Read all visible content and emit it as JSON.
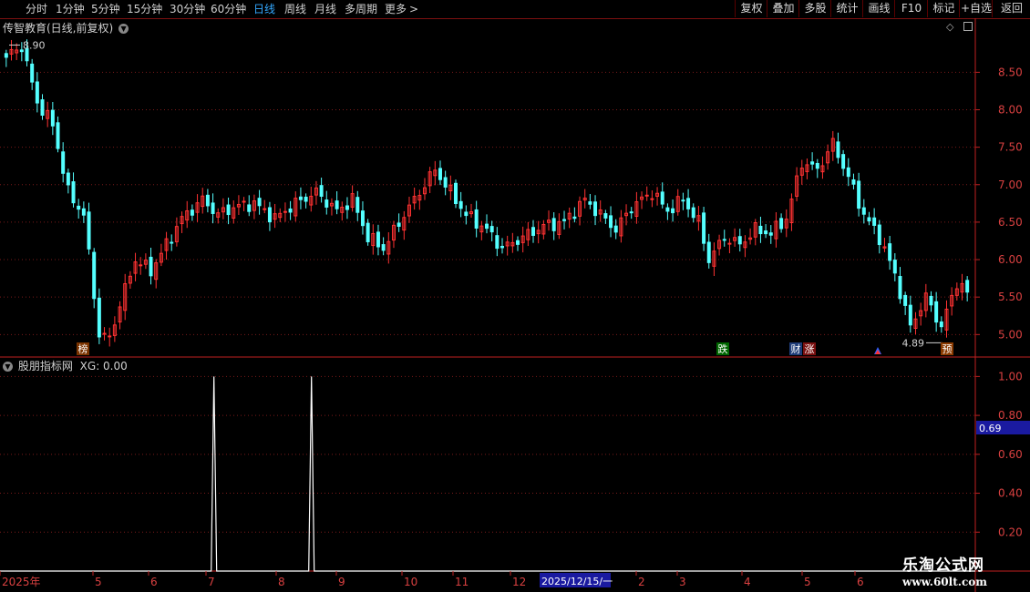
{
  "toolbar": {
    "periods": [
      "分时",
      "1分钟",
      "5分钟",
      "15分钟",
      "30分钟",
      "60分钟",
      "日线",
      "周线",
      "月线",
      "多周期",
      "更多"
    ],
    "active_period": "日线",
    "more_arrow": ">",
    "right_buttons": [
      "复权",
      "叠加",
      "多股",
      "统计",
      "画线",
      "F10",
      "标记",
      "+自选",
      "返回"
    ]
  },
  "main_panel": {
    "title": "传智教育(日线,前复权)",
    "high_label": "8.90",
    "low_label": "4.89",
    "price_ticks": [
      "8.50",
      "8.00",
      "7.50",
      "7.00",
      "6.50",
      "6.00",
      "5.50",
      "5.00"
    ]
  },
  "markers": [
    {
      "text": "榜",
      "bg": "#7a3300"
    },
    {
      "text": "跌",
      "bg": "#006600"
    },
    {
      "text": "财",
      "bg": "#1e3c78"
    },
    {
      "text": "涨",
      "bg": "#7a1010"
    },
    {
      "text": "预",
      "bg": "#8a3a00"
    }
  ],
  "indicator_panel": {
    "title": "股朋指标网",
    "xg_label": "XG: 0.00",
    "ticks": [
      "1.00",
      "0.80",
      "0.60",
      "0.40",
      "0.20"
    ],
    "current_value": "0.69"
  },
  "date_axis": {
    "labels": [
      "2025年",
      "5",
      "6",
      "7",
      "8",
      "9",
      "10",
      "11",
      "12",
      "2",
      "3",
      "4",
      "5",
      "6"
    ],
    "cursor_date": "2025/12/15/一"
  },
  "watermark": {
    "line1": "乐淘公式网",
    "line2": "www.60lt.com"
  },
  "colors": {
    "up": "#ff3232",
    "down": "#54ffff",
    "grid": "#7a1a1a",
    "axis": "#c02020",
    "background": "#000000",
    "active": "#33a8ff"
  },
  "chart_data": {
    "type": "candlestick",
    "title": "传智教育(日线,前复权)",
    "ylim": [
      4.7,
      9.1
    ],
    "annotations": {
      "high": 8.9,
      "low": 4.89
    },
    "x_labels": [
      "2025年",
      "5",
      "6",
      "7",
      "8",
      "9",
      "10",
      "11",
      "12",
      "2025/12/15/一",
      "2",
      "3",
      "4",
      "5",
      "6"
    ],
    "indicator": {
      "name": "XG",
      "value": 0.0,
      "ylim": [
        0,
        1.1
      ],
      "signal_positions": [
        0.21,
        0.31
      ],
      "signal_value": 1.0
    }
  }
}
